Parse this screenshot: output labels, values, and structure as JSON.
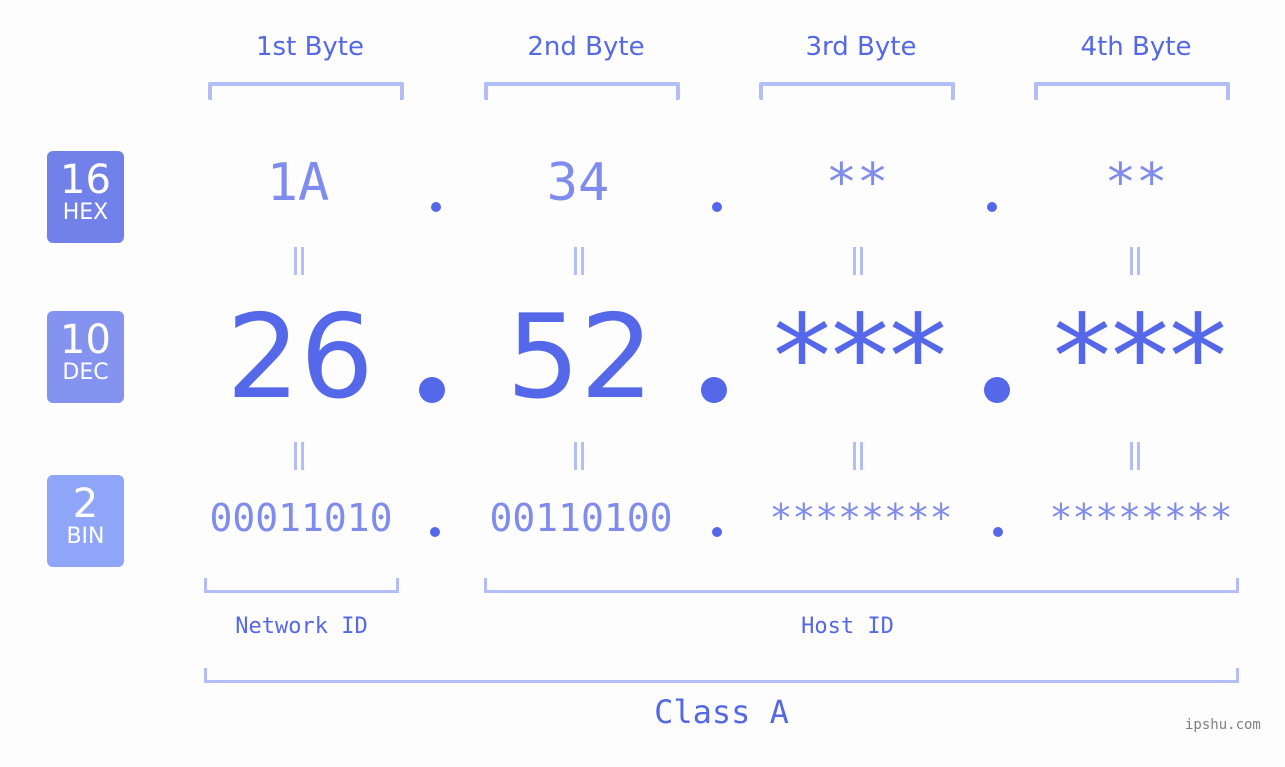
{
  "bytes": {
    "headers": [
      "1st Byte",
      "2nd Byte",
      "3rd Byte",
      "4th Byte"
    ]
  },
  "badges": {
    "hex": {
      "number": "16",
      "label": "HEX",
      "color": "#7280ea"
    },
    "dec": {
      "number": "10",
      "label": "DEC",
      "color": "#8493f0"
    },
    "bin": {
      "number": "2",
      "label": "BIN",
      "color": "#8fa6f8"
    }
  },
  "hex_values": [
    "1A",
    "34",
    "**",
    "**"
  ],
  "dec_values": [
    "26",
    "52",
    "***",
    "***"
  ],
  "bin_values": [
    "00011010",
    "00110100",
    "********",
    "********"
  ],
  "labels": {
    "network_id": "Network ID",
    "host_id": "Host ID",
    "class": "Class A"
  },
  "watermark": "ipshu.com",
  "colors": {
    "accent": "#5568ea",
    "light_accent": "#7f8ced",
    "bracket": "#b3bdf6"
  }
}
